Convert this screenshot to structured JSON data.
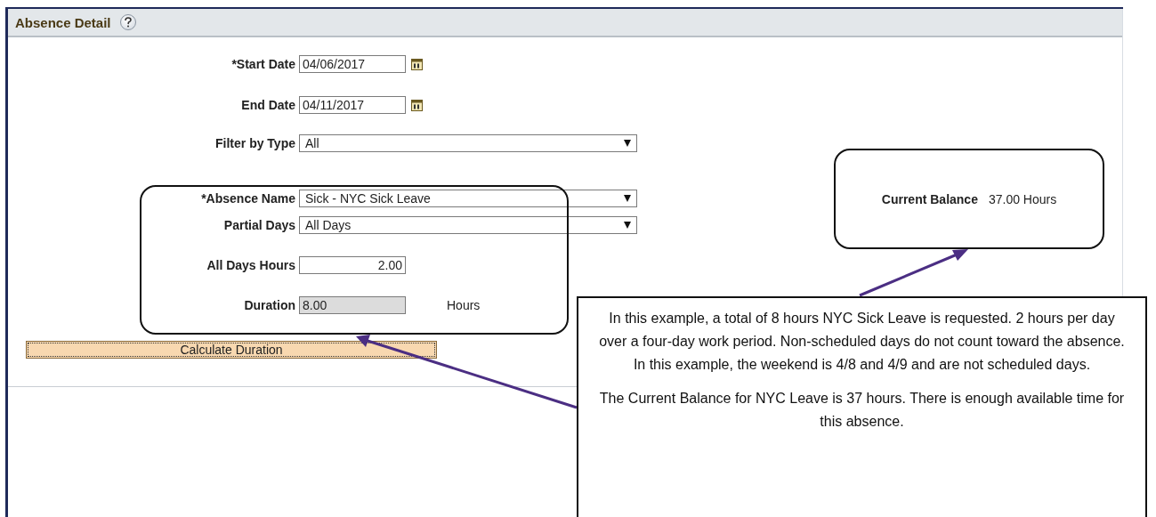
{
  "panel": {
    "title": "Absence Detail"
  },
  "fields": [
    {
      "kind": "date",
      "label": "*Start Date",
      "value": "04/06/2017"
    },
    {
      "kind": "date",
      "label": "End Date",
      "value": "04/11/2017"
    },
    {
      "kind": "select",
      "label": "Filter by Type",
      "value": "All"
    },
    {
      "kind": "select",
      "label": "*Absence Name",
      "value": "Sick - NYC Sick Leave"
    },
    {
      "kind": "select",
      "label": "Partial Days",
      "value": "All Days"
    },
    {
      "kind": "number",
      "label": "All Days Hours",
      "value": "2.00"
    },
    {
      "kind": "readonly",
      "label": "Duration",
      "value": "8.00",
      "unit": "Hours"
    }
  ],
  "calculate_button": "Calculate Duration",
  "balance_callout": {
    "label": "Current Balance",
    "value": "37.00 Hours"
  },
  "note": {
    "paragraphs": [
      "In this example, a total of 8 hours NYC Sick Leave is requested.  2 hours per day over a four-day work period.  Non-scheduled days do not count toward the absence.  In this example, the weekend is 4/8 and 4/9 and are not scheduled days.",
      "The Current Balance for NYC Leave is 37 hours.  There is enough available time for this absence."
    ]
  }
}
